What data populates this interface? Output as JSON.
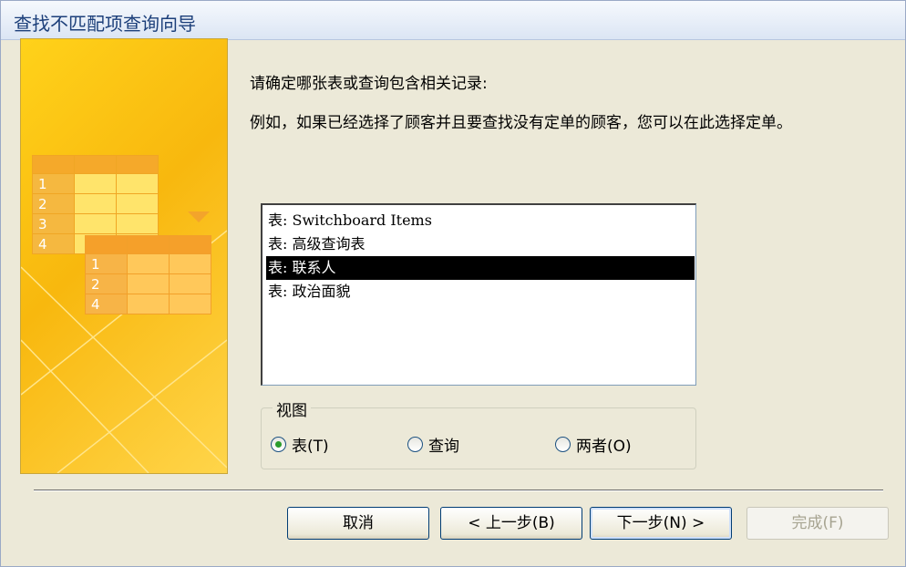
{
  "window": {
    "title": "查找不匹配项查询向导"
  },
  "illustration": {
    "grid_a_numbers": [
      "1",
      "2",
      "3",
      "4"
    ],
    "grid_b_numbers": [
      "1",
      "2",
      "4"
    ]
  },
  "content": {
    "prompt": "请确定哪张表或查询包含相关记录:",
    "example": "例如，如果已经选择了顾客并且要查找没有定单的顾客，您可以在此选择定单。"
  },
  "listbox": {
    "items": [
      {
        "label": "表: Switchboard Items",
        "selected": false
      },
      {
        "label": "表: 高级查询表",
        "selected": false
      },
      {
        "label": "表: 联系人",
        "selected": true
      },
      {
        "label": "表: 政治面貌",
        "selected": false
      }
    ]
  },
  "view_group": {
    "legend": "视图",
    "options": [
      {
        "label": "表(T)",
        "checked": true
      },
      {
        "label": "查询",
        "checked": false
      },
      {
        "label": "两者(O)",
        "checked": false
      }
    ]
  },
  "buttons": {
    "cancel": "取消",
    "back": "< 上一步(B)",
    "next": "下一步(N) >",
    "finish": "完成(F)"
  }
}
